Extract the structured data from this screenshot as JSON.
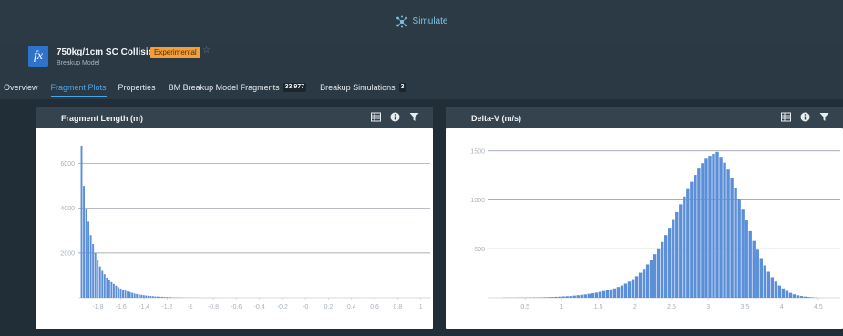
{
  "topbar": {
    "simulate_label": "Simulate",
    "icon": "simulate-cluster-icon"
  },
  "header": {
    "icon_label": "fx",
    "title": "750kg/1cm SC Collision",
    "badge": "Experimental",
    "subtitle": "Breakup Model",
    "star": "☆"
  },
  "tabs": [
    {
      "label": "Overview",
      "active": false
    },
    {
      "label": "Fragment Plots",
      "active": true
    },
    {
      "label": "Properties",
      "active": false
    },
    {
      "label": "BM Breakup Model Fragments",
      "count": "33,977",
      "active": false
    },
    {
      "label": "Breakup Simulations",
      "count": "3",
      "active": false
    }
  ],
  "panels": {
    "fragment_length": {
      "title": "Fragment Length (m)"
    },
    "delta_v": {
      "title": "Delta-V (m/s)"
    }
  },
  "colors": {
    "accent": "#4aa6e6",
    "badge": "#f39f3a",
    "bar": "#5b8fd8",
    "fx": "#2e72cc"
  },
  "chart_data": [
    {
      "type": "bar",
      "title": "Fragment Length (m)",
      "xlim": [
        -1.97,
        1.05
      ],
      "ylim": [
        0,
        7000
      ],
      "x_ticks": [
        "-1.8",
        "-1.6",
        "-1.4",
        "-1.2",
        "-1",
        "-0.8",
        "-0.6",
        "-0.4",
        "-0.2",
        "-0",
        "0.2",
        "0.4",
        "0.6",
        "0.8",
        "1"
      ],
      "y_ticks": [
        "2000",
        "4000",
        "6000"
      ],
      "grid": "horizontal",
      "bin_start": -1.95,
      "bin_width": 0.02,
      "values": [
        6800,
        5000,
        4000,
        3400,
        2800,
        2400,
        2000,
        1700,
        1400,
        1200,
        1050,
        900,
        800,
        700,
        620,
        540,
        470,
        410,
        360,
        320,
        280,
        250,
        220,
        190,
        170,
        150,
        130,
        115,
        100,
        90,
        80,
        70,
        60,
        54,
        48,
        42,
        36,
        32,
        28,
        24,
        20,
        18,
        16,
        14,
        12,
        10,
        9,
        8,
        7,
        6,
        5,
        5,
        4,
        4,
        3,
        3,
        3,
        2,
        2,
        2
      ]
    },
    {
      "type": "bar",
      "title": "Delta-V (m/s)",
      "xlim": [
        0,
        4.75
      ],
      "ylim": [
        0,
        1600
      ],
      "x_ticks": [
        "0.5",
        "1",
        "1.5",
        "2",
        "2.5",
        "3",
        "3.5",
        "4",
        "4.5"
      ],
      "y_ticks": [
        "500",
        "1000",
        "1500"
      ],
      "grid": "horizontal",
      "bin_start": 0.2,
      "bin_width": 0.05,
      "values": [
        2,
        2,
        2,
        2,
        3,
        3,
        3,
        3,
        4,
        4,
        5,
        6,
        7,
        8,
        10,
        12,
        14,
        16,
        18,
        22,
        26,
        30,
        34,
        40,
        46,
        52,
        60,
        68,
        76,
        85,
        95,
        110,
        125,
        145,
        165,
        190,
        220,
        255,
        295,
        340,
        390,
        445,
        505,
        570,
        640,
        715,
        795,
        875,
        955,
        1035,
        1110,
        1185,
        1255,
        1320,
        1375,
        1420,
        1450,
        1470,
        1490,
        1440,
        1380,
        1310,
        1220,
        1120,
        1010,
        900,
        790,
        680,
        580,
        490,
        405,
        330,
        265,
        210,
        165,
        125,
        95,
        70,
        50,
        35,
        25,
        18,
        12,
        8,
        5,
        3
      ]
    }
  ]
}
